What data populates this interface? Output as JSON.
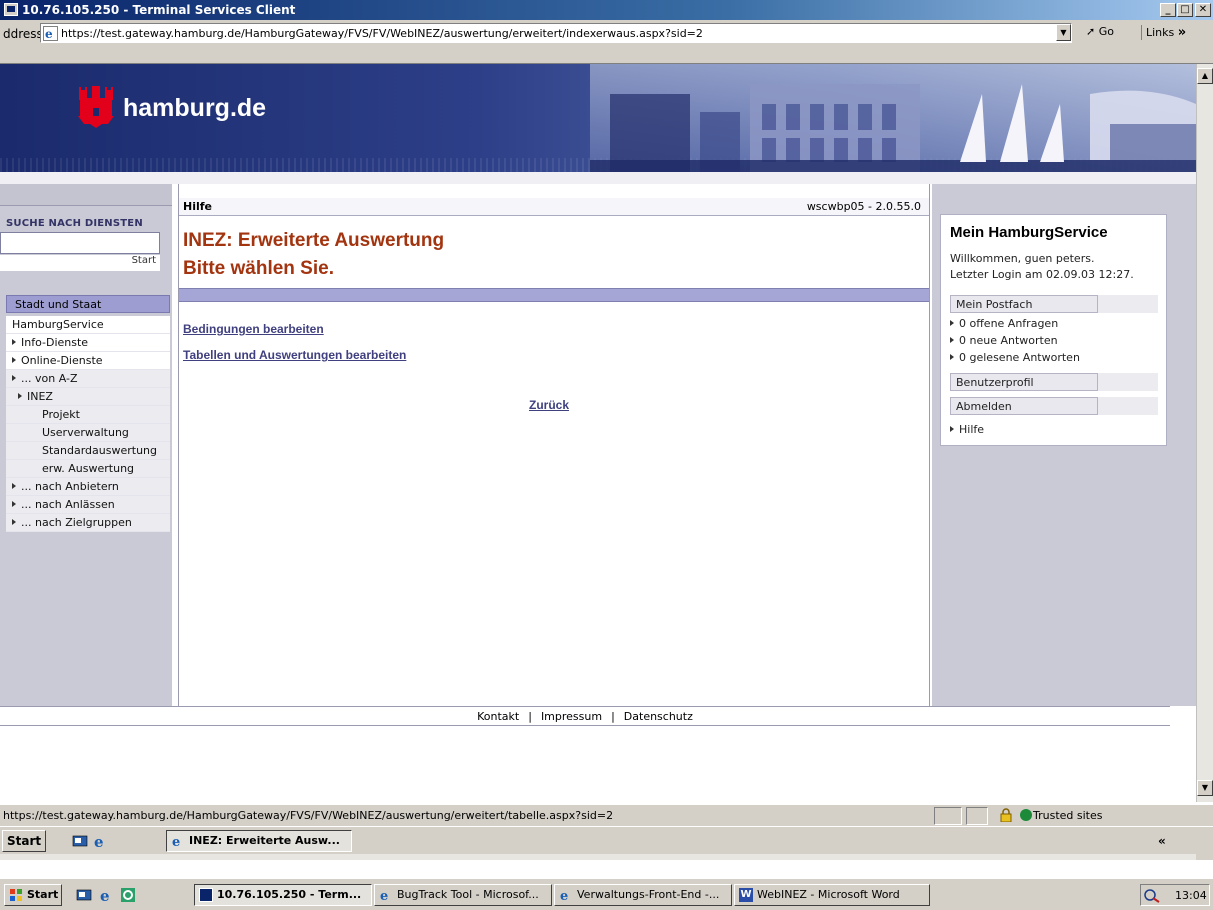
{
  "window": {
    "title": "10.76.105.250 - Terminal Services Client",
    "min_glyph": "_",
    "max_glyph": "□",
    "close_glyph": "✕"
  },
  "address_bar": {
    "label": "ddress",
    "url": "https://test.gateway.hamburg.de/HamburgGateway/FVS/FV/WebINEZ/auswertung/erweitert/indexerwaus.aspx?sid=2",
    "go_label": "Go",
    "links_label": "Links"
  },
  "banner": {
    "logo_text": "hamburg.de"
  },
  "left_nav": {
    "search_title": "SUCHE NACH DIENSTEN",
    "search_value": "",
    "search_button": "Start",
    "section_title": "Stadt und Staat",
    "items": [
      {
        "label": "HamburgService",
        "arrow": false,
        "style": "plain"
      },
      {
        "label": "Info-Dienste",
        "arrow": true,
        "style": "plain"
      },
      {
        "label": "Online-Dienste",
        "arrow": true,
        "style": "plain"
      },
      {
        "label": "... von A-Z",
        "arrow": true,
        "style": "gray"
      },
      {
        "label": "INEZ",
        "arrow": true,
        "style": "gray"
      },
      {
        "label": "Projekt",
        "arrow": false,
        "style": "sub"
      },
      {
        "label": "Userverwaltung",
        "arrow": false,
        "style": "sub"
      },
      {
        "label": "Standardauswertung",
        "arrow": false,
        "style": "sub"
      },
      {
        "label": "erw. Auswertung",
        "arrow": false,
        "style": "sub"
      },
      {
        "label": "... nach Anbietern",
        "arrow": true,
        "style": "gray"
      },
      {
        "label": "... nach Anlässen",
        "arrow": true,
        "style": "gray"
      },
      {
        "label": "... nach Zielgruppen",
        "arrow": true,
        "style": "gray"
      }
    ]
  },
  "center": {
    "help_label": "Hilfe",
    "version": "wscwbp05 - 2.0.55.0",
    "title_line1": "INEZ: Erweiterte Auswertung",
    "title_line2": "Bitte wählen Sie.",
    "link_conditions": "Bedingungen bearbeiten",
    "link_tables": "Tabellen und Auswertungen bearbeiten",
    "link_back": "Zurück"
  },
  "right_panel": {
    "title": "Mein HamburgService",
    "welcome": "Willkommen, guen peters.",
    "last_login": "Letzter Login am 02.09.03 12:27.",
    "postfach_button": "Mein Postfach",
    "postfach_items": [
      "0 offene Anfragen",
      "0 neue Antworten",
      "0 gelesene Antworten"
    ],
    "profile_button": "Benutzerprofil",
    "logout_button": "Abmelden",
    "help_link": "Hilfe"
  },
  "footer": {
    "links": [
      "Kontakt",
      "Impressum",
      "Datenschutz"
    ],
    "separator": "|"
  },
  "status_bar": {
    "url": "https://test.gateway.hamburg.de/HamburgGateway/FVS/FV/WebINEZ/auswertung/erweitert/tabelle.aspx?sid=2",
    "zone": "Trusted sites"
  },
  "inner_taskbar": {
    "start_label": "Start",
    "window_button": "INEZ: Erweiterte Ausw...",
    "chevron": "«"
  },
  "outer_taskbar": {
    "start_label": "Start",
    "buttons": [
      {
        "label": "10.76.105.250 - Term...",
        "active": true
      },
      {
        "label": "BugTrack Tool - Microsof...",
        "active": false
      },
      {
        "label": "Verwaltungs-Front-End -...",
        "active": false
      },
      {
        "label": "WebINEZ - Microsoft Word",
        "active": false
      }
    ],
    "clock": "13:04"
  },
  "colors": {
    "title_red": "#a33410",
    "link_blue": "#404080",
    "nav_header": "#9d9dd1",
    "sidebar_bg": "#cacad6",
    "banner_dark": "#1a2a6c"
  }
}
